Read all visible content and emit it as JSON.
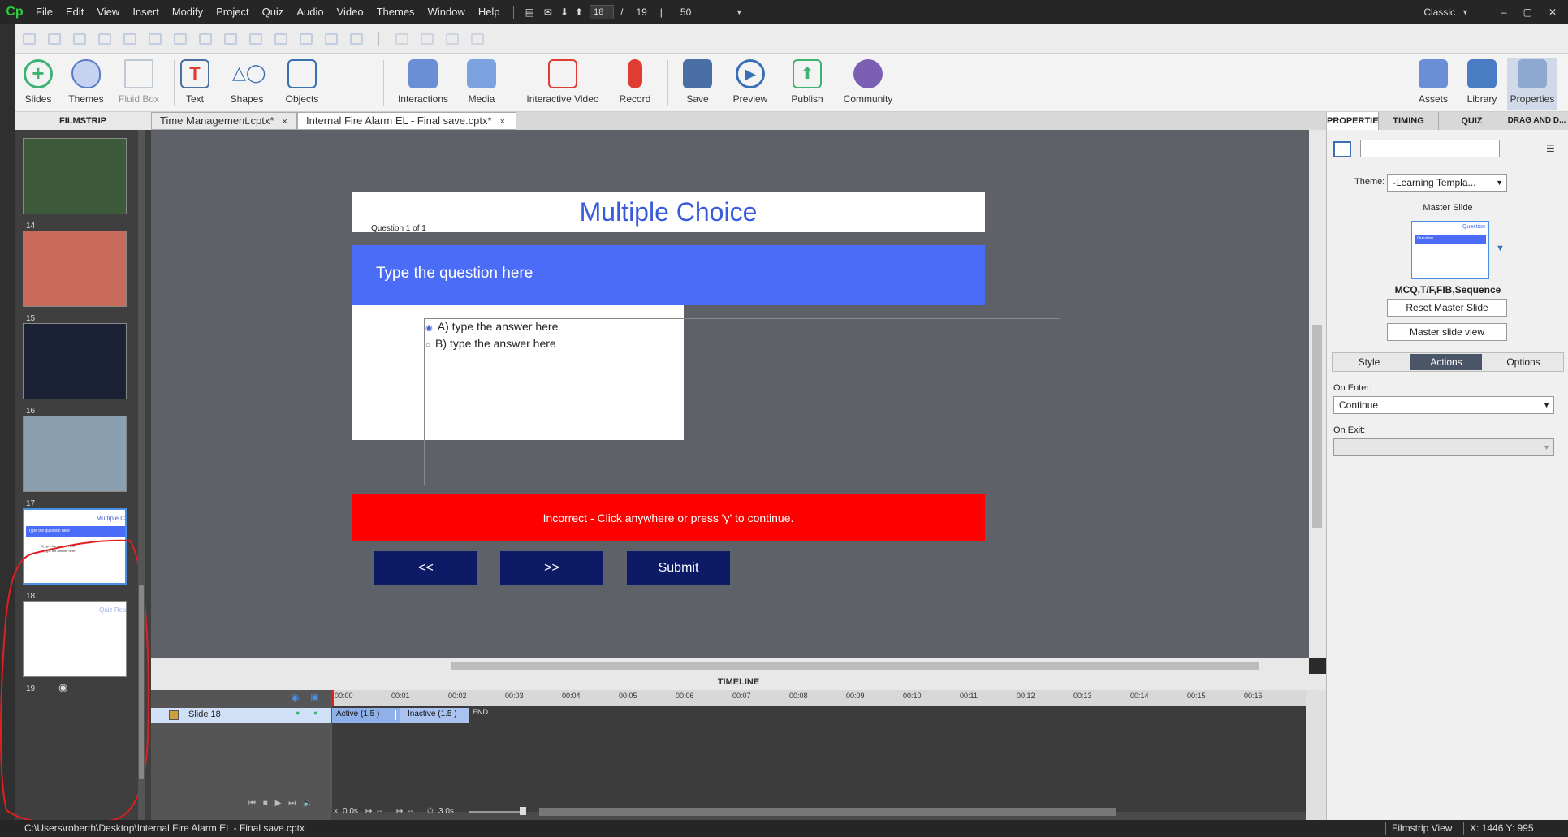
{
  "menubar": {
    "logo": "Cp",
    "items": [
      "File",
      "Edit",
      "View",
      "Insert",
      "Modify",
      "Project",
      "Quiz",
      "Audio",
      "Video",
      "Themes",
      "Window",
      "Help"
    ],
    "current_slide": "18",
    "slash": "/",
    "total_slides": "19",
    "sep": "|",
    "zoom": "50",
    "workspace": "Classic"
  },
  "toolbar": {
    "slides": "Slides",
    "themes": "Themes",
    "fluid_box": "Fluid Box",
    "text": "Text",
    "shapes": "Shapes",
    "objects": "Objects",
    "interactions": "Interactions",
    "media": "Media",
    "interactive_video": "Interactive Video",
    "record": "Record",
    "save": "Save",
    "preview": "Preview",
    "publish": "Publish",
    "community": "Community",
    "assets": "Assets",
    "library": "Library",
    "properties": "Properties"
  },
  "filmstrip": {
    "header": "FILMSTRIP",
    "numbers": [
      "14",
      "15",
      "16",
      "17",
      "18",
      "19"
    ],
    "thumb18_title": "Multiple C",
    "thumb18_question": "Type the question here",
    "thumb18_a": "A) type the answer here",
    "thumb18_b": "B) type the answer here",
    "thumb19_title": "Quiz Res"
  },
  "tabs": [
    {
      "label": "Time Management.cptx*",
      "close": "×"
    },
    {
      "label": "Internal Fire Alarm EL - Final save.cptx*",
      "close": "×"
    }
  ],
  "slide": {
    "title": "Multiple Choice",
    "question_count": "Question 1 of 1",
    "question": "Type the question here",
    "answers": [
      "A) type the answer here",
      "B) type the answer here"
    ],
    "feedback": "Incorrect - Click anywhere or press 'y' to continue.",
    "btn_back": "<<",
    "btn_next": ">>",
    "btn_submit": "Submit"
  },
  "timeline": {
    "header": "TIMELINE",
    "layer": "Slide 18",
    "active": "Active (1.5 )",
    "inactive": "Inactive (1.5 )",
    "end": "END",
    "ticks": [
      "00:00",
      "00:01",
      "00:02",
      "00:03",
      "00:04",
      "00:05",
      "00:06",
      "00:07",
      "00:08",
      "00:09",
      "00:10",
      "00:11",
      "00:12",
      "00:13",
      "00:14",
      "00:15",
      "00:16"
    ],
    "t_current": "0.0s",
    "t_a": "--",
    "t_b": "--",
    "t_duration": "3.0s"
  },
  "properties": {
    "tabs": [
      "PROPERTIES",
      "TIMING",
      "QUIZ",
      "DRAG AND D..."
    ],
    "theme_label": "Theme:",
    "theme_value": "-Learning Templa...",
    "master_slide_label": "Master Slide",
    "master_thumb_title": "Question",
    "master_thumb_bar": "Question",
    "master_name": "MCQ,T/F,FIB,Sequence",
    "reset_master": "Reset Master Slide",
    "master_view": "Master slide view",
    "subtabs": [
      "Style",
      "Actions",
      "Options"
    ],
    "on_enter_label": "On Enter:",
    "on_enter_value": "Continue",
    "on_exit_label": "On Exit:"
  },
  "statusbar": {
    "path": "C:\\Users\\roberth\\Desktop\\Internal Fire Alarm EL - Final save.cptx",
    "view": "Filmstrip View",
    "coords": "X: 1446 Y: 995"
  },
  "colors": {
    "accent": "#4a6cf7",
    "title_blue": "#3a5bd9",
    "feedback_red": "#ff0000",
    "button_navy": "#0d1a66",
    "annotation_red": "#e02020"
  }
}
